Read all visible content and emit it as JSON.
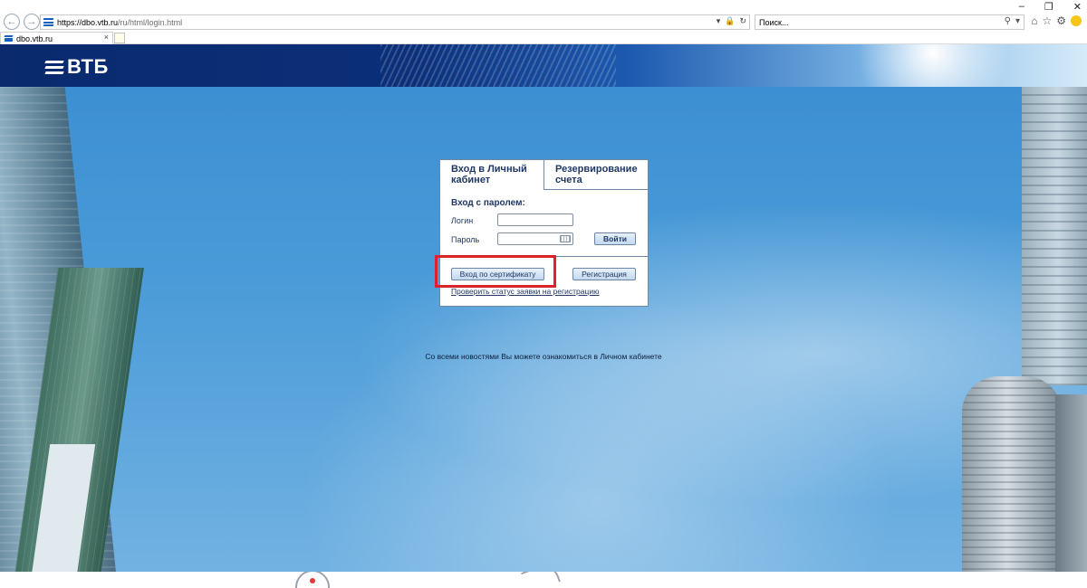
{
  "browser": {
    "url_scheme_host": "https://dbo.vtb.ru",
    "url_path": "/ru/html/login.html",
    "search_placeholder": "Поиск...",
    "tab_title": "dbo.vtb.ru",
    "tab_close": "×",
    "icons": [
      "back-icon",
      "forward-icon",
      "lock-icon",
      "refresh-icon",
      "search-icon",
      "home-icon",
      "star-icon",
      "gear-icon",
      "smiley-icon"
    ]
  },
  "header": {
    "logo_text": "ВТБ"
  },
  "login": {
    "tab_login": "Вход в Личный кабинет",
    "tab_reserve": "Резервирование счета",
    "password_section_title": "Вход с паролем:",
    "login_label": "Логин",
    "password_label": "Пароль",
    "login_value": "",
    "password_value": "",
    "enter_button": "Войти",
    "certificate_button": "Вход по сертификату",
    "register_button": "Регистрация",
    "check_status_link": "Проверить статус заявки на регистрацию"
  },
  "news_text": "Со всеми новостями Вы можете ознакомиться в Личном кабинете",
  "colors": {
    "brand_dark_blue": "#0b2f79",
    "highlight_red": "#d9232d",
    "label_blue": "#1f3864"
  }
}
